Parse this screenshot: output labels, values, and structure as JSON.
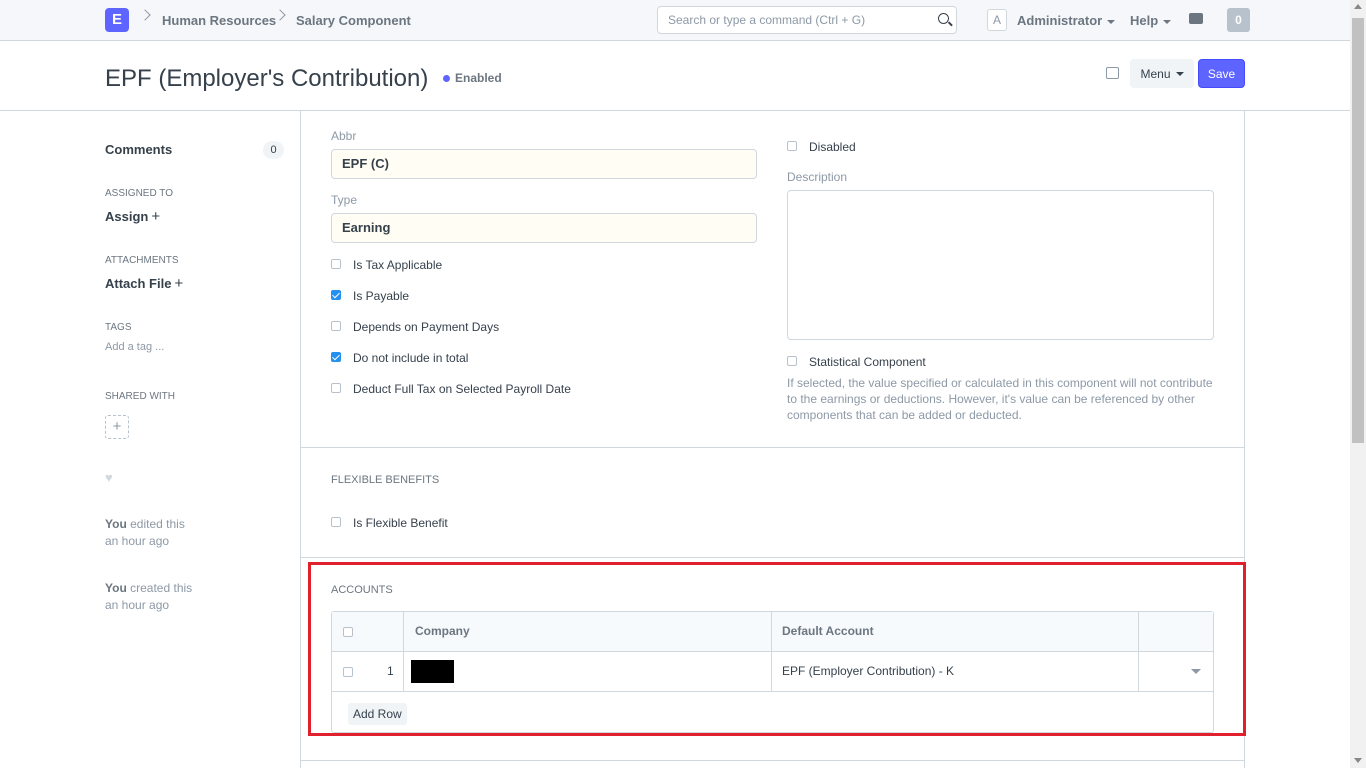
{
  "navbar": {
    "logo": "E",
    "breadcrumbs": [
      "Human Resources",
      "Salary Component"
    ],
    "search_placeholder": "Search or type a command (Ctrl + G)",
    "avatar_letter": "A",
    "user": "Administrator",
    "help": "Help",
    "notifications": "0"
  },
  "page": {
    "title": "EPF (Employer's Contribution)",
    "status": "Enabled",
    "menu_label": "Menu",
    "save_label": "Save"
  },
  "sidebar": {
    "comments_label": "Comments",
    "comments_count": "0",
    "assigned_to_label": "ASSIGNED TO",
    "assign_label": "Assign",
    "attachments_label": "ATTACHMENTS",
    "attach_label": "Attach File",
    "tags_label": "TAGS",
    "add_tag": "Add a tag ...",
    "shared_with_label": "SHARED WITH",
    "activity": [
      {
        "who": "You",
        "what": "edited this",
        "when": "an hour ago"
      },
      {
        "who": "You",
        "what": "created this",
        "when": "an hour ago"
      }
    ]
  },
  "form": {
    "abbr_label": "Abbr",
    "abbr_value": "EPF (C)",
    "type_label": "Type",
    "type_value": "Earning",
    "checkboxes": [
      {
        "label": "Is Tax Applicable",
        "checked": false
      },
      {
        "label": "Is Payable",
        "checked": true
      },
      {
        "label": "Depends on Payment Days",
        "checked": false
      },
      {
        "label": "Do not include in total",
        "checked": true
      },
      {
        "label": "Deduct Full Tax on Selected Payroll Date",
        "checked": false
      }
    ],
    "disabled_label": "Disabled",
    "description_label": "Description",
    "statistical_label": "Statistical Component",
    "statistical_help": "If selected, the value specified or calculated in this component will not contribute to the earnings or deductions. However, it's value can be referenced by other components that can be added or deducted.",
    "flexible_section": "FLEXIBLE BENEFITS",
    "flexible_label": "Is Flexible Benefit",
    "accounts_section": "ACCOUNTS",
    "accounts_table": {
      "columns": [
        "Company",
        "Default Account"
      ],
      "rows": [
        {
          "idx": "1",
          "company": "",
          "default_account": "EPF (Employer Contribution) - K"
        }
      ],
      "add_row": "Add Row"
    }
  },
  "colors": {
    "accent": "#5e64ff",
    "highlight": "#e0202d",
    "checkbox": "#2490ef"
  }
}
